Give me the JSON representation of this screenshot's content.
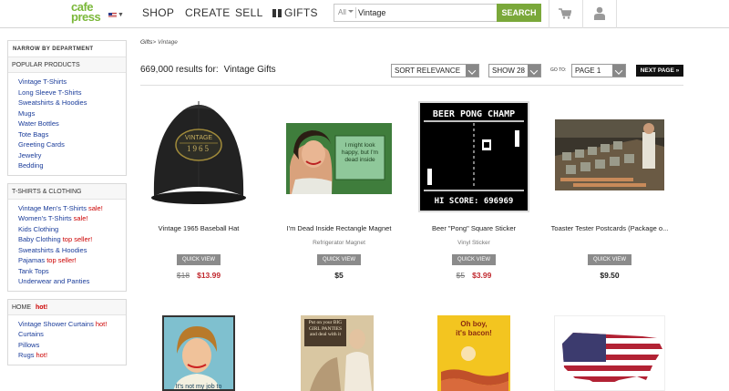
{
  "header": {
    "logo_text_top": "cafe",
    "logo_text_bottom": "press",
    "nav": [
      {
        "label": "SHOP"
      },
      {
        "label": "CREATE"
      },
      {
        "label": "SELL"
      },
      {
        "label": "GIFTS",
        "icon": "gift-icon"
      }
    ],
    "search": {
      "scope": "All",
      "value": "Vintage",
      "button_label": "SEARCH"
    },
    "cart_icon": "cart-icon",
    "account_icon": "user-icon"
  },
  "sidebar": {
    "title": "NARROW BY DEPARTMENT",
    "sections": [
      {
        "heading": "POPULAR PRODUCTS",
        "items": [
          {
            "label": "Vintage T-Shirts"
          },
          {
            "label": "Long Sleeve T-Shirts"
          },
          {
            "label": "Sweatshirts & Hoodies"
          },
          {
            "label": "Mugs"
          },
          {
            "label": "Water Bottles"
          },
          {
            "label": "Tote Bags"
          },
          {
            "label": "Greeting Cards"
          },
          {
            "label": "Jewelry"
          },
          {
            "label": "Bedding"
          }
        ]
      },
      {
        "heading": "T-SHIRTS & CLOTHING",
        "items": [
          {
            "label": "Vintage Men's T-Shirts",
            "tag": "sale!"
          },
          {
            "label": "Women's T-Shirts",
            "tag": "sale!"
          },
          {
            "label": "Kids Clothing"
          },
          {
            "label": "Baby Clothing",
            "tag": "top seller!"
          },
          {
            "label": "Sweatshirts & Hoodies"
          },
          {
            "label": "Pajamas",
            "tag": "top seller!"
          },
          {
            "label": "Tank Tops"
          },
          {
            "label": "Underwear and Panties"
          }
        ]
      },
      {
        "heading": "HOME",
        "hot": "hot!",
        "items": [
          {
            "label": "Vintage Shower Curtains",
            "tag": "hot!"
          },
          {
            "label": "Curtains"
          },
          {
            "label": "Pillows"
          },
          {
            "label": "Rugs",
            "tag": "hot!"
          }
        ]
      }
    ]
  },
  "breadcrumb": {
    "root": "Gifts",
    "current": "Vintage"
  },
  "results": {
    "count_text": "669,000 results for:",
    "query_text": "Vintage Gifts"
  },
  "controls": {
    "sort": "SORT RELEVANCE",
    "per_page": "SHOW 28",
    "goto_label": "GO TO:",
    "page": "PAGE 1",
    "next_label": "NEXT PAGE »"
  },
  "products": [
    {
      "title": "Vintage 1965 Baseball Hat",
      "subtitle": "",
      "quick_view": "QUICK VIEW",
      "old_price": "$18",
      "price": "$13.99",
      "on_sale": true,
      "image_text_1": "VINTAGE",
      "image_text_2": "1965"
    },
    {
      "title": "I'm Dead Inside Rectangle Magnet",
      "subtitle": "Refrigerator Magnet",
      "quick_view": "QUICK VIEW",
      "old_price": "",
      "price": "$5",
      "on_sale": false,
      "image_text": "I might look happy, but I'm dead inside"
    },
    {
      "title": "Beer \"Pong\" Square Sticker",
      "subtitle": "Vinyl Sticker",
      "quick_view": "QUICK VIEW",
      "old_price": "$5",
      "price": "$3.99",
      "on_sale": true,
      "image_text_top": "BEER PONG CHAMP",
      "image_text_bottom": "HI SCORE: 696969"
    },
    {
      "title": "Toaster Tester Postcards (Package o...",
      "subtitle": "",
      "quick_view": "QUICK VIEW",
      "old_price": "",
      "price": "$9.50",
      "on_sale": false
    }
  ],
  "row2": [
    {
      "image_text": "It's not my job to"
    },
    {
      "image_text": "Put on your BIG GIRL PANTIES and deal with it"
    },
    {
      "image_text_1": "Oh boy,",
      "image_text_2": "it's bacon!"
    },
    {}
  ]
}
